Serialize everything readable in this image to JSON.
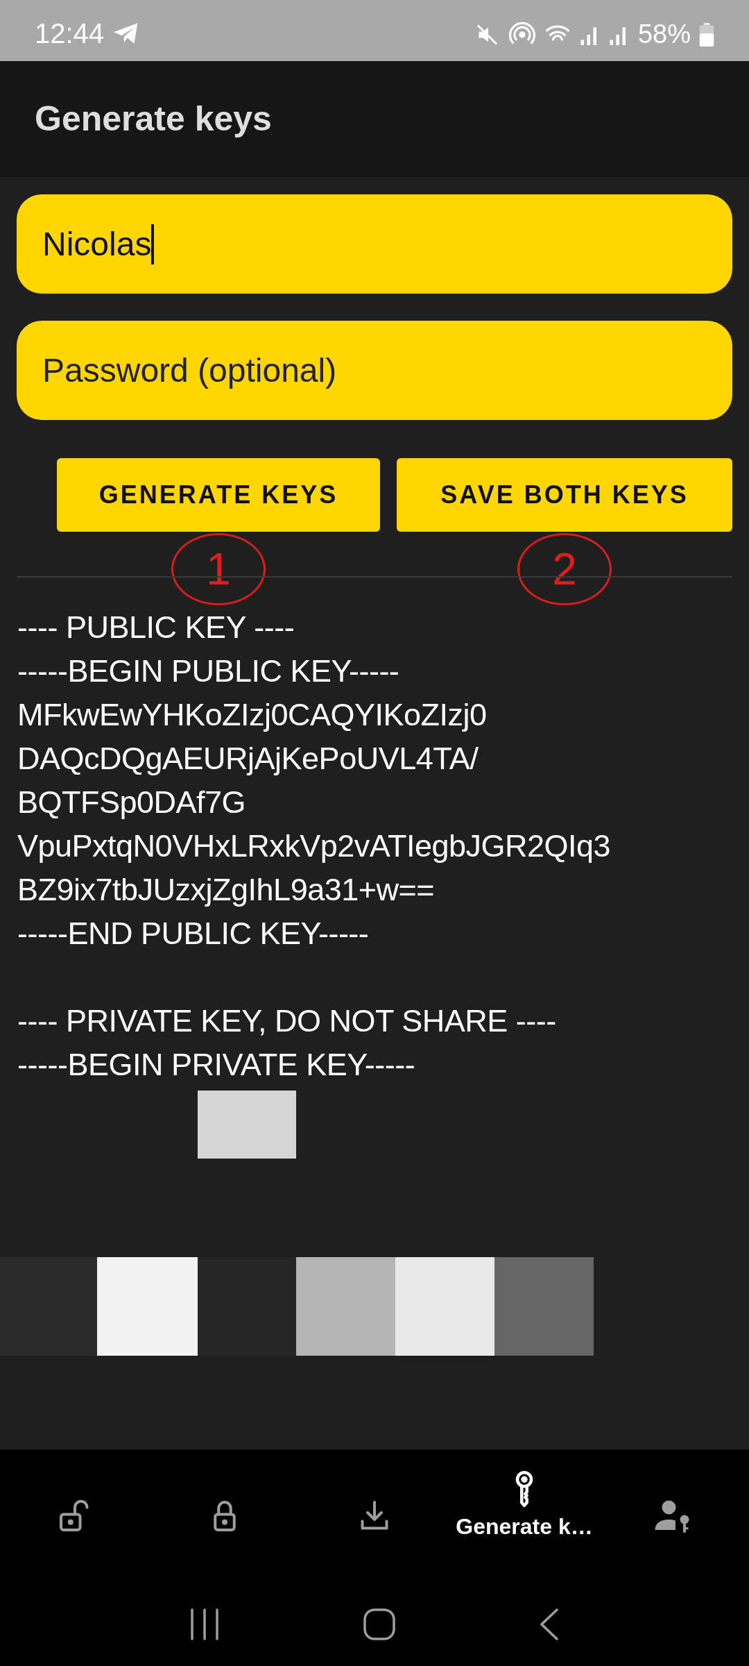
{
  "status_bar": {
    "time": "12:44",
    "battery": "58%"
  },
  "app_bar": {
    "title": "Generate keys"
  },
  "name_field": {
    "value": "Nicolas"
  },
  "password_field": {
    "placeholder": "Password (optional)"
  },
  "buttons": [
    {
      "label": "GENERATE KEYS",
      "annotation": "1"
    },
    {
      "label": "SAVE BOTH KEYS",
      "annotation": "2"
    }
  ],
  "public_key_lines": [
    "---- PUBLIC KEY ----",
    "-----BEGIN PUBLIC KEY-----",
    "MFkwEwYHKoZIzj0CAQYIKoZIzj0",
    "DAQcDQgAEURjAjKePoUVL4TA/",
    "BQTFSp0DAf7G",
    "VpuPxtqN0VHxLRxkVp2vATIegbJGR2QIq3",
    "BZ9ix7tbJUzxjZgIhL9a31+w==",
    "-----END PUBLIC KEY-----"
  ],
  "private_key_lines": [
    "---- PRIVATE KEY, DO NOT SHARE ----",
    "-----BEGIN PRIVATE KEY-----"
  ],
  "bottom_nav": [
    {
      "selected": false
    },
    {
      "selected": false
    },
    {
      "selected": false
    },
    {
      "label": "Generate k…",
      "selected": true
    },
    {
      "selected": false
    }
  ]
}
